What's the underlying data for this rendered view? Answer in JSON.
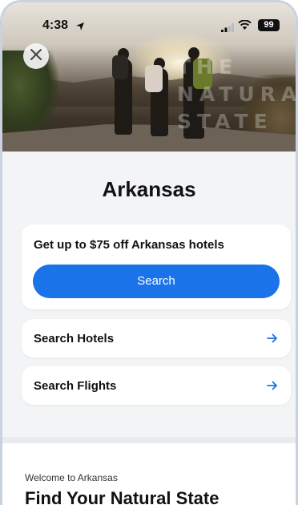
{
  "status_bar": {
    "time": "4:38",
    "battery": "99"
  },
  "hero": {
    "watermark": "THE\nNATURAL\nSTATE"
  },
  "page": {
    "title": "Arkansas"
  },
  "promo": {
    "text": "Get up to $75 off Arkansas hotels",
    "button_label": "Search"
  },
  "links": [
    {
      "label": "Search Hotels"
    },
    {
      "label": "Search Flights"
    }
  ],
  "intro": {
    "eyebrow": "Welcome to Arkansas",
    "heading": "Find Your Natural State"
  },
  "colors": {
    "accent": "#1a73e8",
    "background": "#f3f4f6"
  },
  "icons": [
    "close-icon",
    "location-arrow-icon",
    "signal-icon",
    "wifi-icon",
    "battery-icon",
    "arrow-right-icon"
  ]
}
